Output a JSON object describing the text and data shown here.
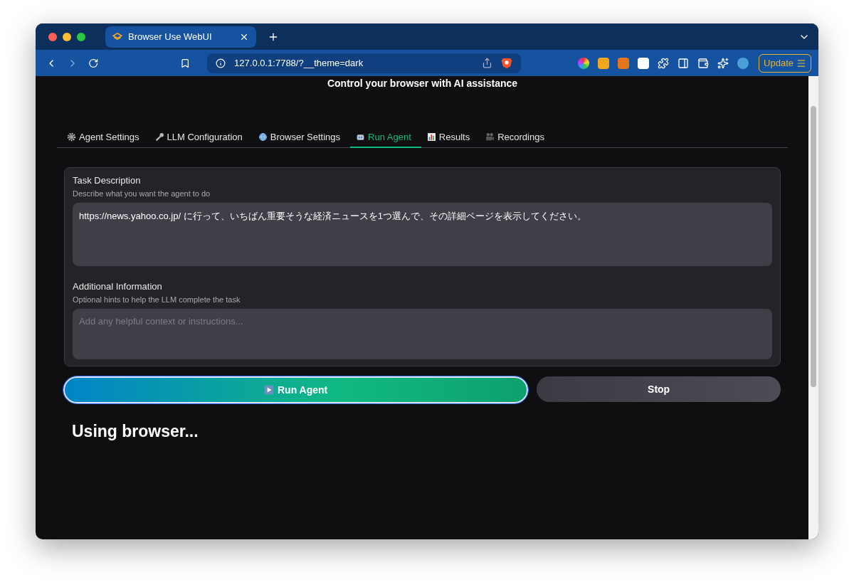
{
  "browser": {
    "tab_title": "Browser Use WebUI",
    "url": "127.0.0.1:7788/?__theme=dark",
    "update_button": "Update"
  },
  "subtitle": "Control your browser with AI assistance",
  "tabs": [
    {
      "label": "Agent Settings",
      "selected": false
    },
    {
      "label": "LLM Configuration",
      "selected": false
    },
    {
      "label": "Browser Settings",
      "selected": false
    },
    {
      "label": "Run Agent",
      "selected": true
    },
    {
      "label": "Results",
      "selected": false
    },
    {
      "label": "Recordings",
      "selected": false
    }
  ],
  "fields": [
    {
      "label": "Task Description",
      "hint": "Describe what you want the agent to do",
      "value": "https://news.yahoo.co.jp/ に行って、いちばん重要そうな経済ニュースを1つ選んで、その詳細ページを表示してください。"
    },
    {
      "label": "Additional Information",
      "hint": "Optional hints to help the LLM complete the task",
      "placeholder": "Add any helpful context or instructions..."
    }
  ],
  "run_button": "Run Agent",
  "stop_button": "Stop",
  "status": "Using browser..."
}
